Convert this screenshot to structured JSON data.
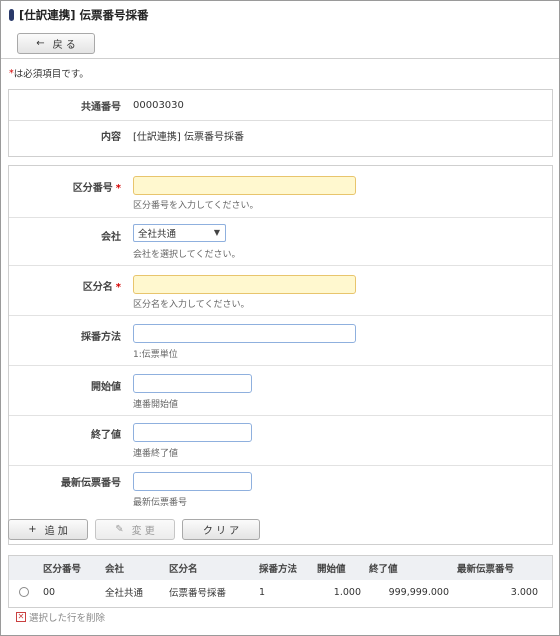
{
  "header": {
    "title": "[仕訳連携] 伝票番号採番"
  },
  "toolbar": {
    "back_icon": "←",
    "back_label": "戻 る"
  },
  "required_note": {
    "mark": "*",
    "text": " は必須項目です。"
  },
  "info": {
    "rows": [
      {
        "label": "共通番号",
        "value": "00003030"
      },
      {
        "label": "内容",
        "value": "[仕訳連携] 伝票番号採番"
      }
    ]
  },
  "form": {
    "required_mark": "*",
    "fields": {
      "category_no": {
        "label": "区分番号",
        "value": "",
        "hint": "区分番号を入力してください。"
      },
      "company": {
        "label": "会社",
        "selected": "全社共通",
        "hint": "会社を選択してください。"
      },
      "category_name": {
        "label": "区分名",
        "value": "",
        "hint": "区分名を入力してください。"
      },
      "numbering_method": {
        "label": "採番方法",
        "value": "",
        "hint": "1:伝票単位"
      },
      "start_value": {
        "label": "開始値",
        "value": "",
        "hint": "連番開始値"
      },
      "end_value": {
        "label": "終了値",
        "value": "",
        "hint": "連番終了値"
      },
      "latest_no": {
        "label": "最新伝票番号",
        "value": "",
        "hint": "最新伝票番号"
      }
    }
  },
  "actions": {
    "add_icon": "+",
    "add_label": "追 加",
    "edit_icon": "✎",
    "edit_label": "変 更",
    "clear_label": "ク リ ア"
  },
  "table": {
    "headers": [
      "区分番号",
      "会社",
      "区分名",
      "採番方法",
      "開始値",
      "終了値",
      "最新伝票番号"
    ],
    "rows": [
      {
        "category_no": "00",
        "company": "全社共通",
        "category_name": "伝票番号採番",
        "method": "1",
        "start": "1.000",
        "end": "999,999.000",
        "latest": "3.000"
      }
    ]
  },
  "delete": {
    "icon": "✕",
    "label": "選択した行を削除"
  },
  "colors": {
    "accent": "#2a3a6a",
    "required": "#d40000",
    "required_bg": "#fff8cf",
    "input_border": "#8fb0de"
  }
}
